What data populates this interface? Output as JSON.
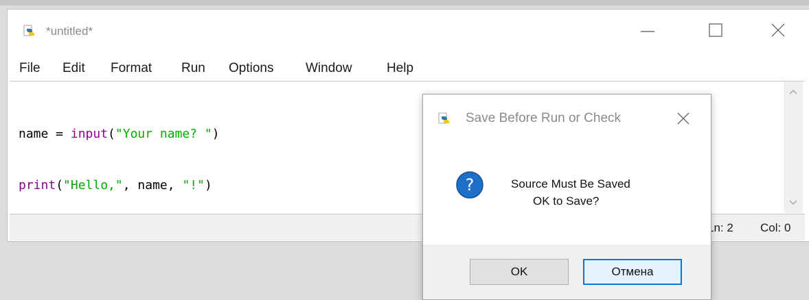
{
  "editor_window": {
    "title": "*untitled*",
    "menu": [
      "File",
      "Edit",
      "Format",
      "Run",
      "Options",
      "Window",
      "Help"
    ],
    "code_lines": [
      [
        {
          "text": "name = ",
          "kind": "plain"
        },
        {
          "text": "input",
          "kind": "builtin"
        },
        {
          "text": "(",
          "kind": "plain"
        },
        {
          "text": "\"Your name? \"",
          "kind": "string"
        },
        {
          "text": ")",
          "kind": "plain"
        }
      ],
      [
        {
          "text": "print",
          "kind": "builtin"
        },
        {
          "text": "(",
          "kind": "plain"
        },
        {
          "text": "\"Hello,\"",
          "kind": "string"
        },
        {
          "text": ", name, ",
          "kind": "plain"
        },
        {
          "text": "\"!\"",
          "kind": "string"
        },
        {
          "text": ")",
          "kind": "plain"
        }
      ]
    ],
    "status": {
      "ln": "Ln: 2",
      "col": "Col: 0"
    }
  },
  "dialog": {
    "title": "Save Before Run or Check",
    "message_line1": "Source Must Be Saved",
    "message_line2": "OK to Save?",
    "ok_label": "OK",
    "cancel_label": "Отмена"
  },
  "colors": {
    "builtin": "#900090",
    "string": "#00aa00",
    "focus_border": "#0078d7",
    "question_icon": "#1e6fc8"
  },
  "icons": {
    "app": "python-icon",
    "dialog": "python-icon",
    "message": "question-icon"
  }
}
